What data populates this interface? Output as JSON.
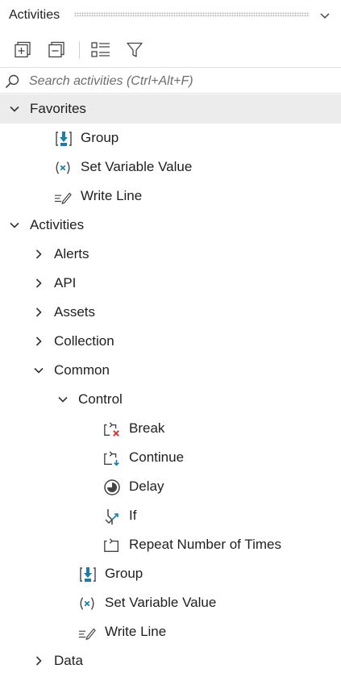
{
  "panel": {
    "title": "Activities"
  },
  "toolbar": {
    "buttons": [
      {
        "name": "expand-all",
        "icon": "expand-all-icon"
      },
      {
        "name": "collapse-all",
        "icon": "collapse-all-icon"
      },
      {
        "name": "list-view",
        "icon": "list-view-icon"
      },
      {
        "name": "filter",
        "icon": "filter-icon"
      }
    ]
  },
  "search": {
    "placeholder": "Search activities (Ctrl+Alt+F)",
    "value": ""
  },
  "tree": {
    "favorites": {
      "label": "Favorites",
      "expanded": true,
      "items": [
        {
          "label": "Group",
          "icon": "group-icon"
        },
        {
          "label": "Set Variable Value",
          "icon": "set-variable-icon"
        },
        {
          "label": "Write Line",
          "icon": "write-line-icon"
        }
      ]
    },
    "activities": {
      "label": "Activities",
      "expanded": true,
      "categories": {
        "alerts": "Alerts",
        "api": "API",
        "assets": "Assets",
        "collection": "Collection",
        "common": "Common",
        "data": "Data"
      },
      "common": {
        "control": {
          "label": "Control",
          "items": [
            {
              "label": "Break",
              "icon": "break-icon"
            },
            {
              "label": "Continue",
              "icon": "continue-icon"
            },
            {
              "label": "Delay",
              "icon": "delay-icon"
            },
            {
              "label": "If",
              "icon": "if-icon"
            },
            {
              "label": "Repeat Number of Times",
              "icon": "repeat-icon"
            }
          ]
        },
        "items": [
          {
            "label": "Group",
            "icon": "group-icon"
          },
          {
            "label": "Set Variable Value",
            "icon": "set-variable-icon"
          },
          {
            "label": "Write Line",
            "icon": "write-line-icon"
          }
        ]
      }
    }
  },
  "colors": {
    "accent_teal": "#1a7fa6",
    "error_red": "#d32f2f",
    "selected_row": "#ececec",
    "icon_gray": "#444444"
  }
}
